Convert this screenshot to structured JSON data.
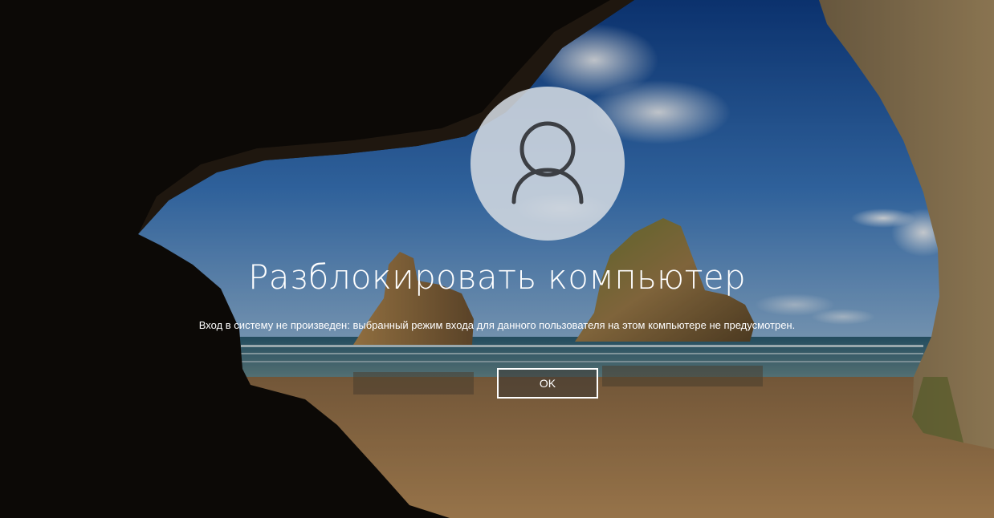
{
  "lock_screen": {
    "avatar_icon": "user-icon",
    "title": "Разблокировать компьютер",
    "message": "Вход в систему не произведен: выбранный режим входа для данного пользователя на этом компьютере не предусмотрен.",
    "ok_label": "OK"
  },
  "colors": {
    "text": "#ffffff",
    "avatar_bg": "#d2d8e0",
    "avatar_glyph": "#3c3f44"
  }
}
